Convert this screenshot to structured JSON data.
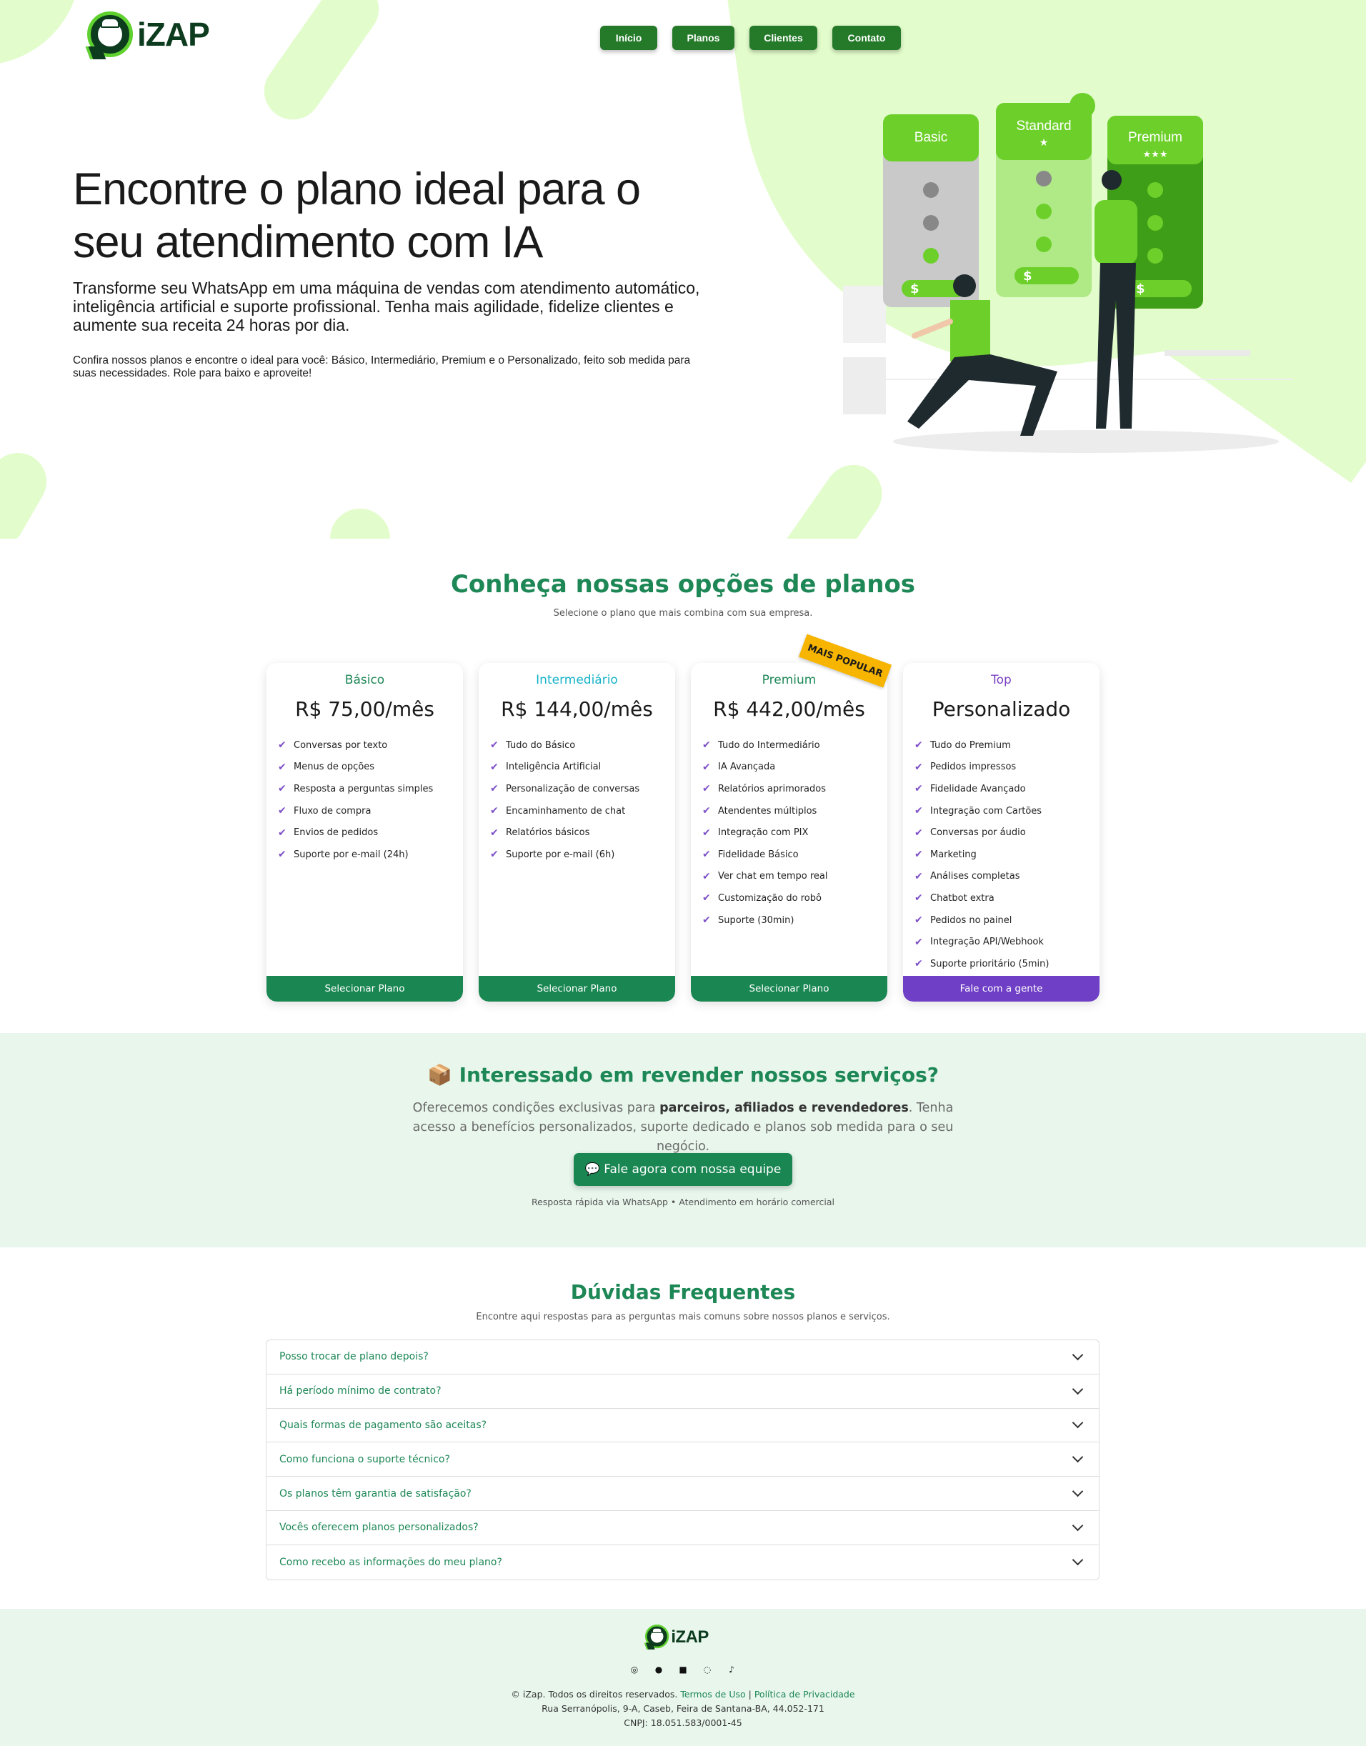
{
  "brand": {
    "name": "iZAP"
  },
  "nav": {
    "items": [
      {
        "label": "Início"
      },
      {
        "label": "Planos"
      },
      {
        "label": "Clientes"
      },
      {
        "label": "Contato"
      }
    ]
  },
  "hero": {
    "title": "Encontre o plano ideal para o seu atendimento com IA",
    "lead": "Transforme seu WhatsApp em uma máquina de vendas com atendimento automático, inteligência artificial e suporte profissional. Tenha mais agilidade, fidelize clientes e aumente sua receita 24 horas por dia.",
    "note": "Confira nossos planos e encontre o ideal para você: Básico, Intermediário, Premium e o Personalizado, feito sob medida para suas necessidades. Role para baixo e aproveite!",
    "illustration": {
      "tiers": [
        "Basic",
        "Standard",
        "Premium"
      ],
      "currency_symbol": "$"
    }
  },
  "plans_section": {
    "title": "Conheça nossas opções de planos",
    "subtitle": "Selecione o plano que mais combina com sua empresa.",
    "badge": "MAIS POPULAR",
    "plans": [
      {
        "name": "Básico",
        "price": "R$ 75,00/mês",
        "button": "Selecionar Plano",
        "name_color": "#1d8756",
        "button_color": "#1a8753",
        "features": [
          "Conversas por texto",
          "Menus de opções",
          "Resposta a perguntas simples",
          "Fluxo de compra",
          "Envios de pedidos",
          "Suporte por e-mail (24h)"
        ]
      },
      {
        "name": "Intermediário",
        "price": "R$ 144,00/mês",
        "button": "Selecionar Plano",
        "name_color": "#16b3c8",
        "button_color": "#1a8753",
        "features": [
          "Tudo do Básico",
          "Inteligência Artificial",
          "Personalização de conversas",
          "Encaminhamento de chat",
          "Relatórios básicos",
          "Suporte por e-mail (6h)"
        ]
      },
      {
        "name": "Premium",
        "price": "R$ 442,00/mês",
        "button": "Selecionar Plano",
        "name_color": "#1d8756",
        "button_color": "#1a8753",
        "features": [
          "Tudo do Intermediário",
          "IA Avançada",
          "Relatórios aprimorados",
          "Atendentes múltiplos",
          "Integração com PIX",
          "Fidelidade Básico",
          "Ver chat em tempo real",
          "Customização do robô",
          "Suporte (30min)"
        ]
      },
      {
        "name": "Top",
        "price": "Personalizado",
        "button": "Fale com a gente",
        "name_color": "#7a3fc4",
        "button_color": "#6f3fc6",
        "features": [
          "Tudo do Premium",
          "Pedidos impressos",
          "Fidelidade Avançado",
          "Integração com Cartões",
          "Conversas por áudio",
          "Marketing",
          "Análises completas",
          "Chatbot extra",
          "Pedidos no painel",
          "Integração API/Webhook",
          "Suporte prioritário (5min)"
        ]
      }
    ]
  },
  "resell": {
    "icon": "📦",
    "title": "Interessado em revender nossos serviços?",
    "desc_a": "Oferecemos condições exclusivas para ",
    "desc_b": "parceiros, afiliados e revendedores",
    "desc_c": ". Tenha acesso a benefícios personalizados, suporte dedicado e planos sob medida para o seu negócio.",
    "cta_icon": "💬",
    "cta": "Fale agora com nossa equipe",
    "note": "Resposta rápida via WhatsApp • Atendimento em horário comercial"
  },
  "faq": {
    "title": "Dúvidas Frequentes",
    "subtitle": "Encontre aqui respostas para as perguntas mais comuns sobre nossos planos e serviços.",
    "items": [
      "Posso trocar de plano depois?",
      "Há período mínimo de contrato?",
      "Quais formas de pagamento são aceitas?",
      "Como funciona o suporte técnico?",
      "Os planos têm garantia de satisfação?",
      "Vocês oferecem planos personalizados?",
      "Como recebo as informações do meu plano?"
    ]
  },
  "footer": {
    "social": [
      "instagram-icon",
      "facebook-icon",
      "linkedin-icon",
      "whatsapp-icon",
      "tiktok-icon"
    ],
    "copyright": "© iZap. Todos os direitos reservados.",
    "terms": "Termos de Uso",
    "separator": "|",
    "privacy": "Política de Privacidade",
    "address": "Rua Serranópolis, 9-A, Caseb, Feira de Santana-BA, 44.052-171",
    "cnpj": "CNPJ: 18.051.583/0001-45"
  }
}
